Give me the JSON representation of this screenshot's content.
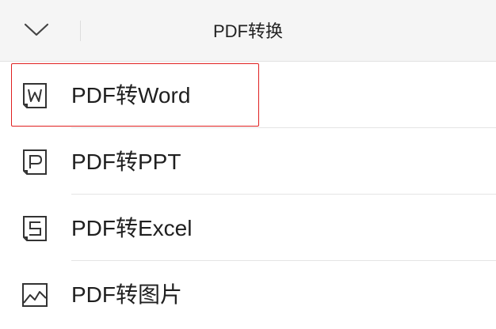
{
  "header": {
    "title": "PDF转换",
    "back_icon": "chevron-down-icon"
  },
  "list": {
    "items": [
      {
        "label": "PDF转Word",
        "icon": "word-doc-icon",
        "selected": true
      },
      {
        "label": "PDF转PPT",
        "icon": "ppt-doc-icon",
        "selected": false
      },
      {
        "label": "PDF转Excel",
        "icon": "excel-doc-icon",
        "selected": false
      },
      {
        "label": "PDF转图片",
        "icon": "image-icon",
        "selected": false
      }
    ]
  },
  "colors": {
    "highlight": "#e02020",
    "header_bg": "#f5f5f5",
    "text": "#1f1f1f"
  }
}
